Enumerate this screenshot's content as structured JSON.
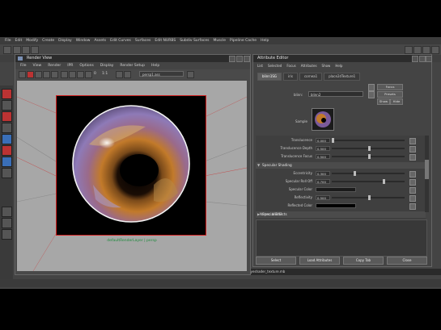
{
  "menubar": {
    "items": [
      "File",
      "Edit",
      "Modify",
      "Create",
      "Display",
      "Window",
      "Assets",
      "Edit Curves",
      "Surfaces",
      "Edit NURBS",
      "Subdiv Surfaces",
      "Muscle",
      "Pipeline Cache",
      "Help"
    ]
  },
  "render_view": {
    "title": "Render View",
    "menu": [
      "File",
      "View",
      "Render",
      "IPR",
      "Options",
      "Display",
      "Render Setup",
      "Help"
    ],
    "toolbar_values": [
      "0",
      "1:1"
    ],
    "camera_dropdown": "persp1.ass",
    "caption": "defaultRenderLayer | persp"
  },
  "attribute_editor": {
    "title": "Attribute Editor",
    "menu": [
      "List",
      "Selected",
      "Focus",
      "Attributes",
      "Show",
      "Help"
    ],
    "tabs": [
      "blinn1SG",
      "iris",
      "cornea1",
      "place2dTexture1"
    ],
    "focus_button": "Focus",
    "presets_button": "Presets",
    "show_button": "Show",
    "hide_button": "Hide",
    "material_label": "blinn:",
    "material_name": "blinn2",
    "sample_label": "Sample",
    "rows": [
      {
        "label": "Translucence",
        "value": "0.000",
        "slider": 0.0,
        "type": "slider"
      },
      {
        "label": "Translucence Depth",
        "value": "0.500",
        "slider": 0.5,
        "type": "slider"
      },
      {
        "label": "Translucence Focus",
        "value": "0.500",
        "slider": 0.5,
        "type": "slider"
      }
    ],
    "section_specular": "Specular Shading",
    "specular_rows": [
      {
        "label": "Eccentricity",
        "value": "0.300",
        "slider": 0.3,
        "type": "slider"
      },
      {
        "label": "Specular Roll Off",
        "value": "0.700",
        "slider": 0.7,
        "type": "slider"
      },
      {
        "label": "Specular Color",
        "value": "",
        "color": "#1a1a1a",
        "type": "color"
      },
      {
        "label": "Reflectivity",
        "value": "0.500",
        "slider": 0.5,
        "type": "slider"
      },
      {
        "label": "Reflected Color",
        "value": "",
        "color": "#000000",
        "type": "color"
      }
    ],
    "section_special": "Special Effects",
    "notes_label": "Notes: blinn2",
    "buttons": [
      "Select",
      "Load Attributes",
      "Copy Tab",
      "Close"
    ]
  },
  "command_line": {
    "text": "//Result: C:/eyeshader_texture.mb"
  },
  "colors": {
    "iris_orange": "#c27a2a",
    "iris_purple": "#8e7ab7",
    "border_red": "#d02020",
    "caption_green": "#1b8a3a"
  }
}
